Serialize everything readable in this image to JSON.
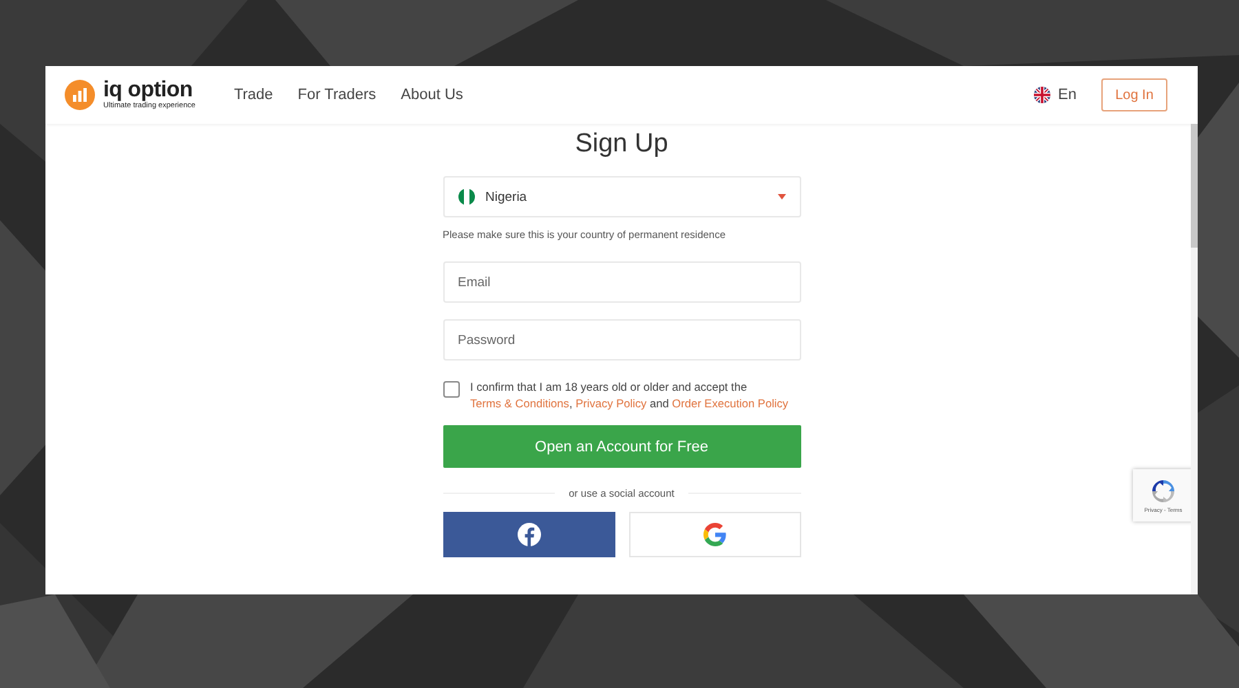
{
  "header": {
    "logo": {
      "name": "iq option",
      "tagline": "Ultimate trading experience"
    },
    "nav": [
      {
        "label": "Trade"
      },
      {
        "label": "For Traders"
      },
      {
        "label": "About Us"
      }
    ],
    "language": "En",
    "login": "Log In"
  },
  "signup": {
    "title": "Sign Up",
    "country": {
      "value": "Nigeria"
    },
    "country_hint": "Please make sure this is your country of permanent residence",
    "fields": [
      {
        "placeholder": "Email"
      },
      {
        "placeholder": "Password"
      }
    ],
    "consent": {
      "checked": false,
      "parts": [
        {
          "text": "I confirm that I am 18 years old or older and accept the ",
          "link": false
        },
        {
          "text": "Terms & Conditions",
          "link": true
        },
        {
          "text": ", ",
          "link": false
        },
        {
          "text": "Privacy Policy",
          "link": true
        },
        {
          "text": " and ",
          "link": false
        },
        {
          "text": "Order Execution Policy",
          "link": true
        }
      ]
    },
    "submit": "Open an Account for Free",
    "divider": "or use a social account",
    "social": [
      {
        "kind": "facebook"
      },
      {
        "kind": "google"
      }
    ]
  },
  "recaptcha": {
    "text": "Privacy - Terms"
  }
}
